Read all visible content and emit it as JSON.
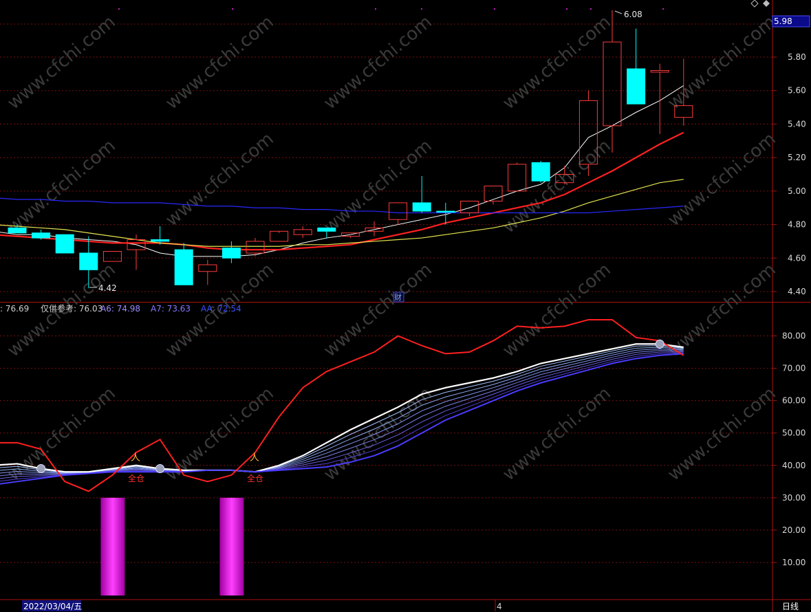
{
  "chart_data": {
    "type": "candlestick",
    "price_panel": {
      "ylim": [
        4.36,
        6.18
      ],
      "yticks": [
        "5.80",
        "5.60",
        "5.40",
        "5.20",
        "5.00",
        "4.80",
        "4.60",
        "4.40"
      ],
      "current_price_label": "5.98",
      "high_marker": "6.08",
      "low_marker": "4.42",
      "finance_marker": "财",
      "candles": [
        {
          "o": 4.78,
          "h": 4.8,
          "l": 4.75,
          "c": 4.75,
          "up": false
        },
        {
          "o": 4.75,
          "h": 4.77,
          "l": 4.71,
          "c": 4.72,
          "up": false
        },
        {
          "o": 4.74,
          "h": 4.74,
          "l": 4.63,
          "c": 4.63,
          "up": false
        },
        {
          "o": 4.63,
          "h": 4.73,
          "l": 4.42,
          "c": 4.53,
          "up": false
        },
        {
          "o": 4.58,
          "h": 4.64,
          "l": 4.58,
          "c": 4.64,
          "up": true
        },
        {
          "o": 4.65,
          "h": 4.74,
          "l": 4.53,
          "c": 4.71,
          "up": true
        },
        {
          "o": 4.71,
          "h": 4.79,
          "l": 4.68,
          "c": 4.7,
          "up": false
        },
        {
          "o": 4.65,
          "h": 4.69,
          "l": 4.44,
          "c": 4.44,
          "up": false
        },
        {
          "o": 4.52,
          "h": 4.59,
          "l": 4.44,
          "c": 4.56,
          "up": true
        },
        {
          "o": 4.6,
          "h": 4.7,
          "l": 4.57,
          "c": 4.66,
          "up": false
        },
        {
          "o": 4.63,
          "h": 4.72,
          "l": 4.61,
          "c": 4.7,
          "up": true
        },
        {
          "o": 4.7,
          "h": 4.75,
          "l": 4.7,
          "c": 4.76,
          "up": true
        },
        {
          "o": 4.74,
          "h": 4.79,
          "l": 4.72,
          "c": 4.77,
          "up": true
        },
        {
          "o": 4.78,
          "h": 4.78,
          "l": 4.72,
          "c": 4.76,
          "up": false
        },
        {
          "o": 4.73,
          "h": 4.75,
          "l": 4.72,
          "c": 4.75,
          "up": true
        },
        {
          "o": 4.76,
          "h": 4.82,
          "l": 4.73,
          "c": 4.78,
          "up": true
        },
        {
          "o": 4.83,
          "h": 4.93,
          "l": 4.8,
          "c": 4.93,
          "up": true
        },
        {
          "o": 4.93,
          "h": 5.09,
          "l": 4.87,
          "c": 4.88,
          "up": false
        },
        {
          "o": 4.88,
          "h": 4.93,
          "l": 4.8,
          "c": 4.88,
          "up": false
        },
        {
          "o": 4.87,
          "h": 4.94,
          "l": 4.85,
          "c": 4.94,
          "up": true
        },
        {
          "o": 4.94,
          "h": 5.03,
          "l": 4.92,
          "c": 5.03,
          "up": true
        },
        {
          "o": 5.0,
          "h": 5.17,
          "l": 5.0,
          "c": 5.16,
          "up": true
        },
        {
          "o": 5.17,
          "h": 5.18,
          "l": 5.05,
          "c": 5.06,
          "up": false
        },
        {
          "o": 5.05,
          "h": 5.15,
          "l": 5.04,
          "c": 5.1,
          "up": true
        },
        {
          "o": 5.16,
          "h": 5.6,
          "l": 5.09,
          "c": 5.54,
          "up": true
        },
        {
          "o": 5.39,
          "h": 6.08,
          "l": 5.23,
          "c": 5.89,
          "up": true
        },
        {
          "o": 5.73,
          "h": 5.97,
          "l": 5.52,
          "c": 5.52,
          "up": false
        },
        {
          "o": 5.71,
          "h": 5.76,
          "l": 5.34,
          "c": 5.72,
          "up": true
        },
        {
          "o": 5.51,
          "h": 5.79,
          "l": 5.39,
          "c": 5.44,
          "up": true
        }
      ],
      "ma_series": [
        {
          "color": "#ffffff",
          "values": [
            4.76,
            4.74,
            4.74,
            4.72,
            4.71,
            4.7,
            4.68,
            4.63,
            4.61,
            4.61,
            4.61,
            4.62,
            4.65,
            4.69,
            4.72,
            4.74,
            4.77,
            4.8,
            4.83,
            4.86,
            4.9,
            4.95,
            5.0,
            5.04,
            5.14,
            5.32,
            5.39,
            5.47,
            5.54,
            5.63
          ]
        },
        {
          "color": "#ff2020",
          "values": [
            4.74,
            4.73,
            4.72,
            4.71,
            4.7,
            4.69,
            4.69,
            4.69,
            4.68,
            4.66,
            4.65,
            4.65,
            4.65,
            4.66,
            4.67,
            4.68,
            4.71,
            4.74,
            4.77,
            4.81,
            4.84,
            4.87,
            4.9,
            4.93,
            4.98,
            5.05,
            5.12,
            5.2,
            5.28,
            5.35
          ]
        },
        {
          "color": "#e6e650",
          "values": [
            4.8,
            4.79,
            4.78,
            4.77,
            4.75,
            4.73,
            4.71,
            4.69,
            4.68,
            4.67,
            4.67,
            4.67,
            4.67,
            4.68,
            4.68,
            4.69,
            4.7,
            4.71,
            4.72,
            4.74,
            4.76,
            4.78,
            4.81,
            4.84,
            4.88,
            4.93,
            4.97,
            5.01,
            5.05,
            5.07
          ]
        },
        {
          "color": "#2828ff",
          "values": [
            4.96,
            4.95,
            4.95,
            4.94,
            4.94,
            4.93,
            4.93,
            4.93,
            4.92,
            4.91,
            4.91,
            4.9,
            4.9,
            4.89,
            4.89,
            4.88,
            4.88,
            4.87,
            4.87,
            4.87,
            4.87,
            4.87,
            4.87,
            4.87,
            4.87,
            4.87,
            4.88,
            4.89,
            4.9,
            4.91
          ]
        }
      ]
    },
    "indicator_panel": {
      "ylim": [
        0,
        88
      ],
      "yticks": [
        "80.00",
        "70.00",
        "60.00",
        "50.00",
        "40.00",
        "30.00",
        "20.00",
        "10.00"
      ],
      "legend": [
        {
          "text": ": 76.69",
          "color": "#cfcfcf"
        },
        {
          "text": "仅供参考: 76.03",
          "color": "#cfcfcf"
        },
        {
          "text": "A6: 74.98",
          "color": "#9b8cff"
        },
        {
          "text": "A7: 73.63",
          "color": "#8878ff"
        },
        {
          "text": "AA: 72.54",
          "color": "#3c50ff"
        }
      ],
      "red_line": [
        47,
        47,
        45,
        35,
        32,
        37,
        44,
        48,
        37,
        35,
        37,
        44,
        55,
        64,
        69,
        72,
        75,
        80,
        77,
        74.5,
        75,
        78.5,
        83,
        82.5,
        83,
        85,
        85,
        79.5,
        78.5,
        74
      ],
      "white_line": [
        40,
        40.5,
        39,
        38,
        38,
        39,
        40,
        39,
        38.5,
        38.5,
        38.5,
        38,
        40,
        43,
        47,
        51,
        54.5,
        58,
        62,
        64,
        65.5,
        67,
        69,
        71.5,
        73,
        74.5,
        76,
        77.5,
        77.5,
        76.5
      ],
      "blue_line": [
        34,
        35,
        36,
        37,
        37.5,
        38,
        38,
        38,
        38,
        38.5,
        38.5,
        38,
        38.5,
        39,
        39.5,
        41,
        43,
        46,
        50,
        54,
        57,
        60,
        63,
        65.5,
        67.5,
        69.5,
        71.5,
        73,
        74,
        74.5
      ],
      "signals": [
        {
          "index": 6,
          "label": "全仓"
        },
        {
          "index": 11,
          "label": "全仓"
        }
      ],
      "circle_markers": [
        2,
        7,
        28
      ],
      "histogram": [
        {
          "index": 5,
          "value": 30
        },
        {
          "index": 10,
          "value": 30
        }
      ]
    },
    "date_label": "2022/03/04/五",
    "month_label": "4",
    "period_label": "日线"
  }
}
